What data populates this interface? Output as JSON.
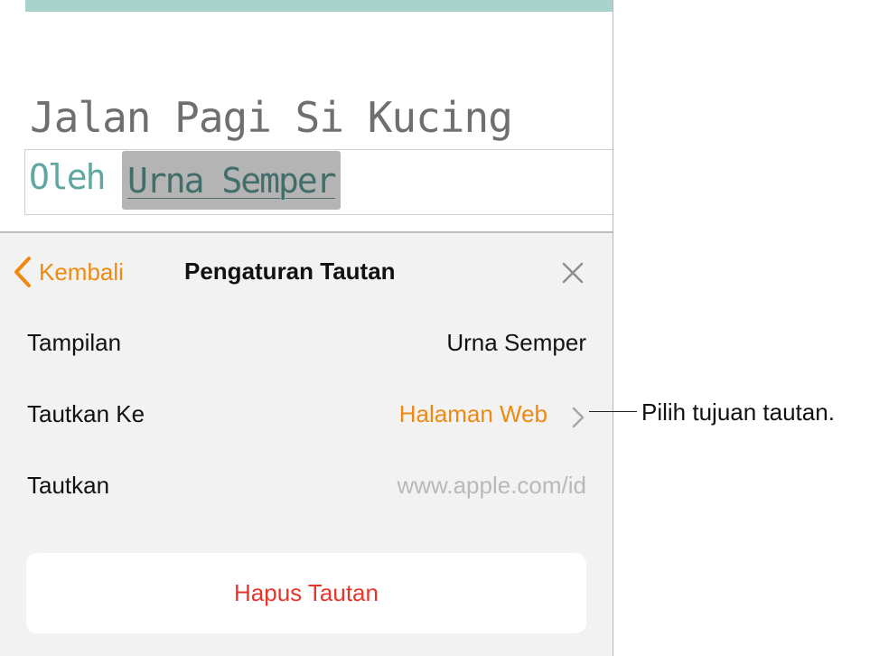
{
  "document": {
    "title": "Jalan Pagi Si Kucing",
    "byline_prefix": "Oleh",
    "byline_link": "Urna Semper"
  },
  "panel": {
    "back_label": "Kembali",
    "title": "Pengaturan Tautan",
    "rows": [
      {
        "label": "Tampilan",
        "value": "Urna Semper"
      },
      {
        "label": "Tautkan Ke",
        "value": "Halaman Web"
      },
      {
        "label": "Tautkan",
        "value": "www.apple.com/id"
      }
    ],
    "delete_label": "Hapus Tautan"
  },
  "callout": {
    "text": "Pilih tujuan tautan."
  },
  "colors": {
    "accent": "#ee8a13",
    "destructive": "#e8352b",
    "byline_teal": "#5fa8a2",
    "top_bar": "#a8d3cd"
  },
  "icons": [
    "chevron-left-icon",
    "close-icon",
    "chevron-right-icon"
  ]
}
